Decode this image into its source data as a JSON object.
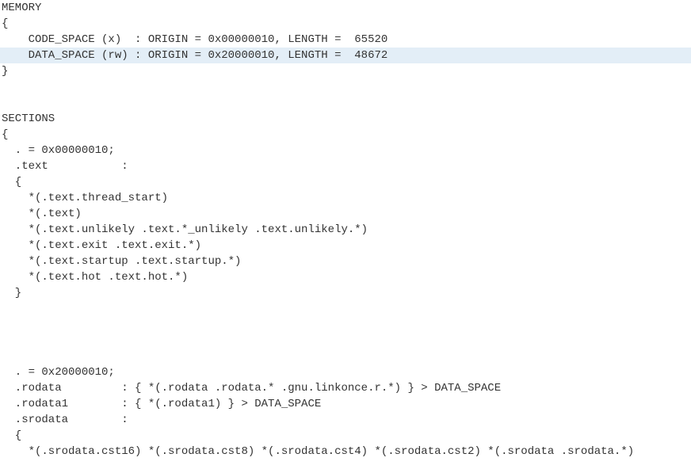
{
  "lines": [
    {
      "text": "MEMORY",
      "hl": false
    },
    {
      "text": "{",
      "hl": false
    },
    {
      "text": "    CODE_SPACE (x)  : ORIGIN = 0x00000010, LENGTH =  65520",
      "hl": false
    },
    {
      "text": "    DATA_SPACE (rw) : ORIGIN = 0x20000010, LENGTH =  48672",
      "hl": true
    },
    {
      "text": "}",
      "hl": false
    },
    {
      "text": "",
      "hl": false
    },
    {
      "text": "",
      "hl": false
    },
    {
      "text": "SECTIONS",
      "hl": false
    },
    {
      "text": "{",
      "hl": false
    },
    {
      "text": "  . = 0x00000010;",
      "hl": false
    },
    {
      "text": "  .text           :",
      "hl": false
    },
    {
      "text": "  {",
      "hl": false
    },
    {
      "text": "    *(.text.thread_start)",
      "hl": false
    },
    {
      "text": "    *(.text)",
      "hl": false
    },
    {
      "text": "    *(.text.unlikely .text.*_unlikely .text.unlikely.*)",
      "hl": false
    },
    {
      "text": "    *(.text.exit .text.exit.*)",
      "hl": false
    },
    {
      "text": "    *(.text.startup .text.startup.*)",
      "hl": false
    },
    {
      "text": "    *(.text.hot .text.hot.*)",
      "hl": false
    },
    {
      "text": "  }",
      "hl": false
    },
    {
      "text": "",
      "hl": false
    },
    {
      "text": "",
      "hl": false
    },
    {
      "text": "",
      "hl": false
    },
    {
      "text": "",
      "hl": false
    },
    {
      "text": "  . = 0x20000010;",
      "hl": false
    },
    {
      "text": "  .rodata         : { *(.rodata .rodata.* .gnu.linkonce.r.*) } > DATA_SPACE",
      "hl": false
    },
    {
      "text": "  .rodata1        : { *(.rodata1) } > DATA_SPACE",
      "hl": false
    },
    {
      "text": "  .srodata        :",
      "hl": false
    },
    {
      "text": "  {",
      "hl": false
    },
    {
      "text": "    *(.srodata.cst16) *(.srodata.cst8) *(.srodata.cst4) *(.srodata.cst2) *(.srodata .srodata.*)",
      "hl": false
    }
  ]
}
